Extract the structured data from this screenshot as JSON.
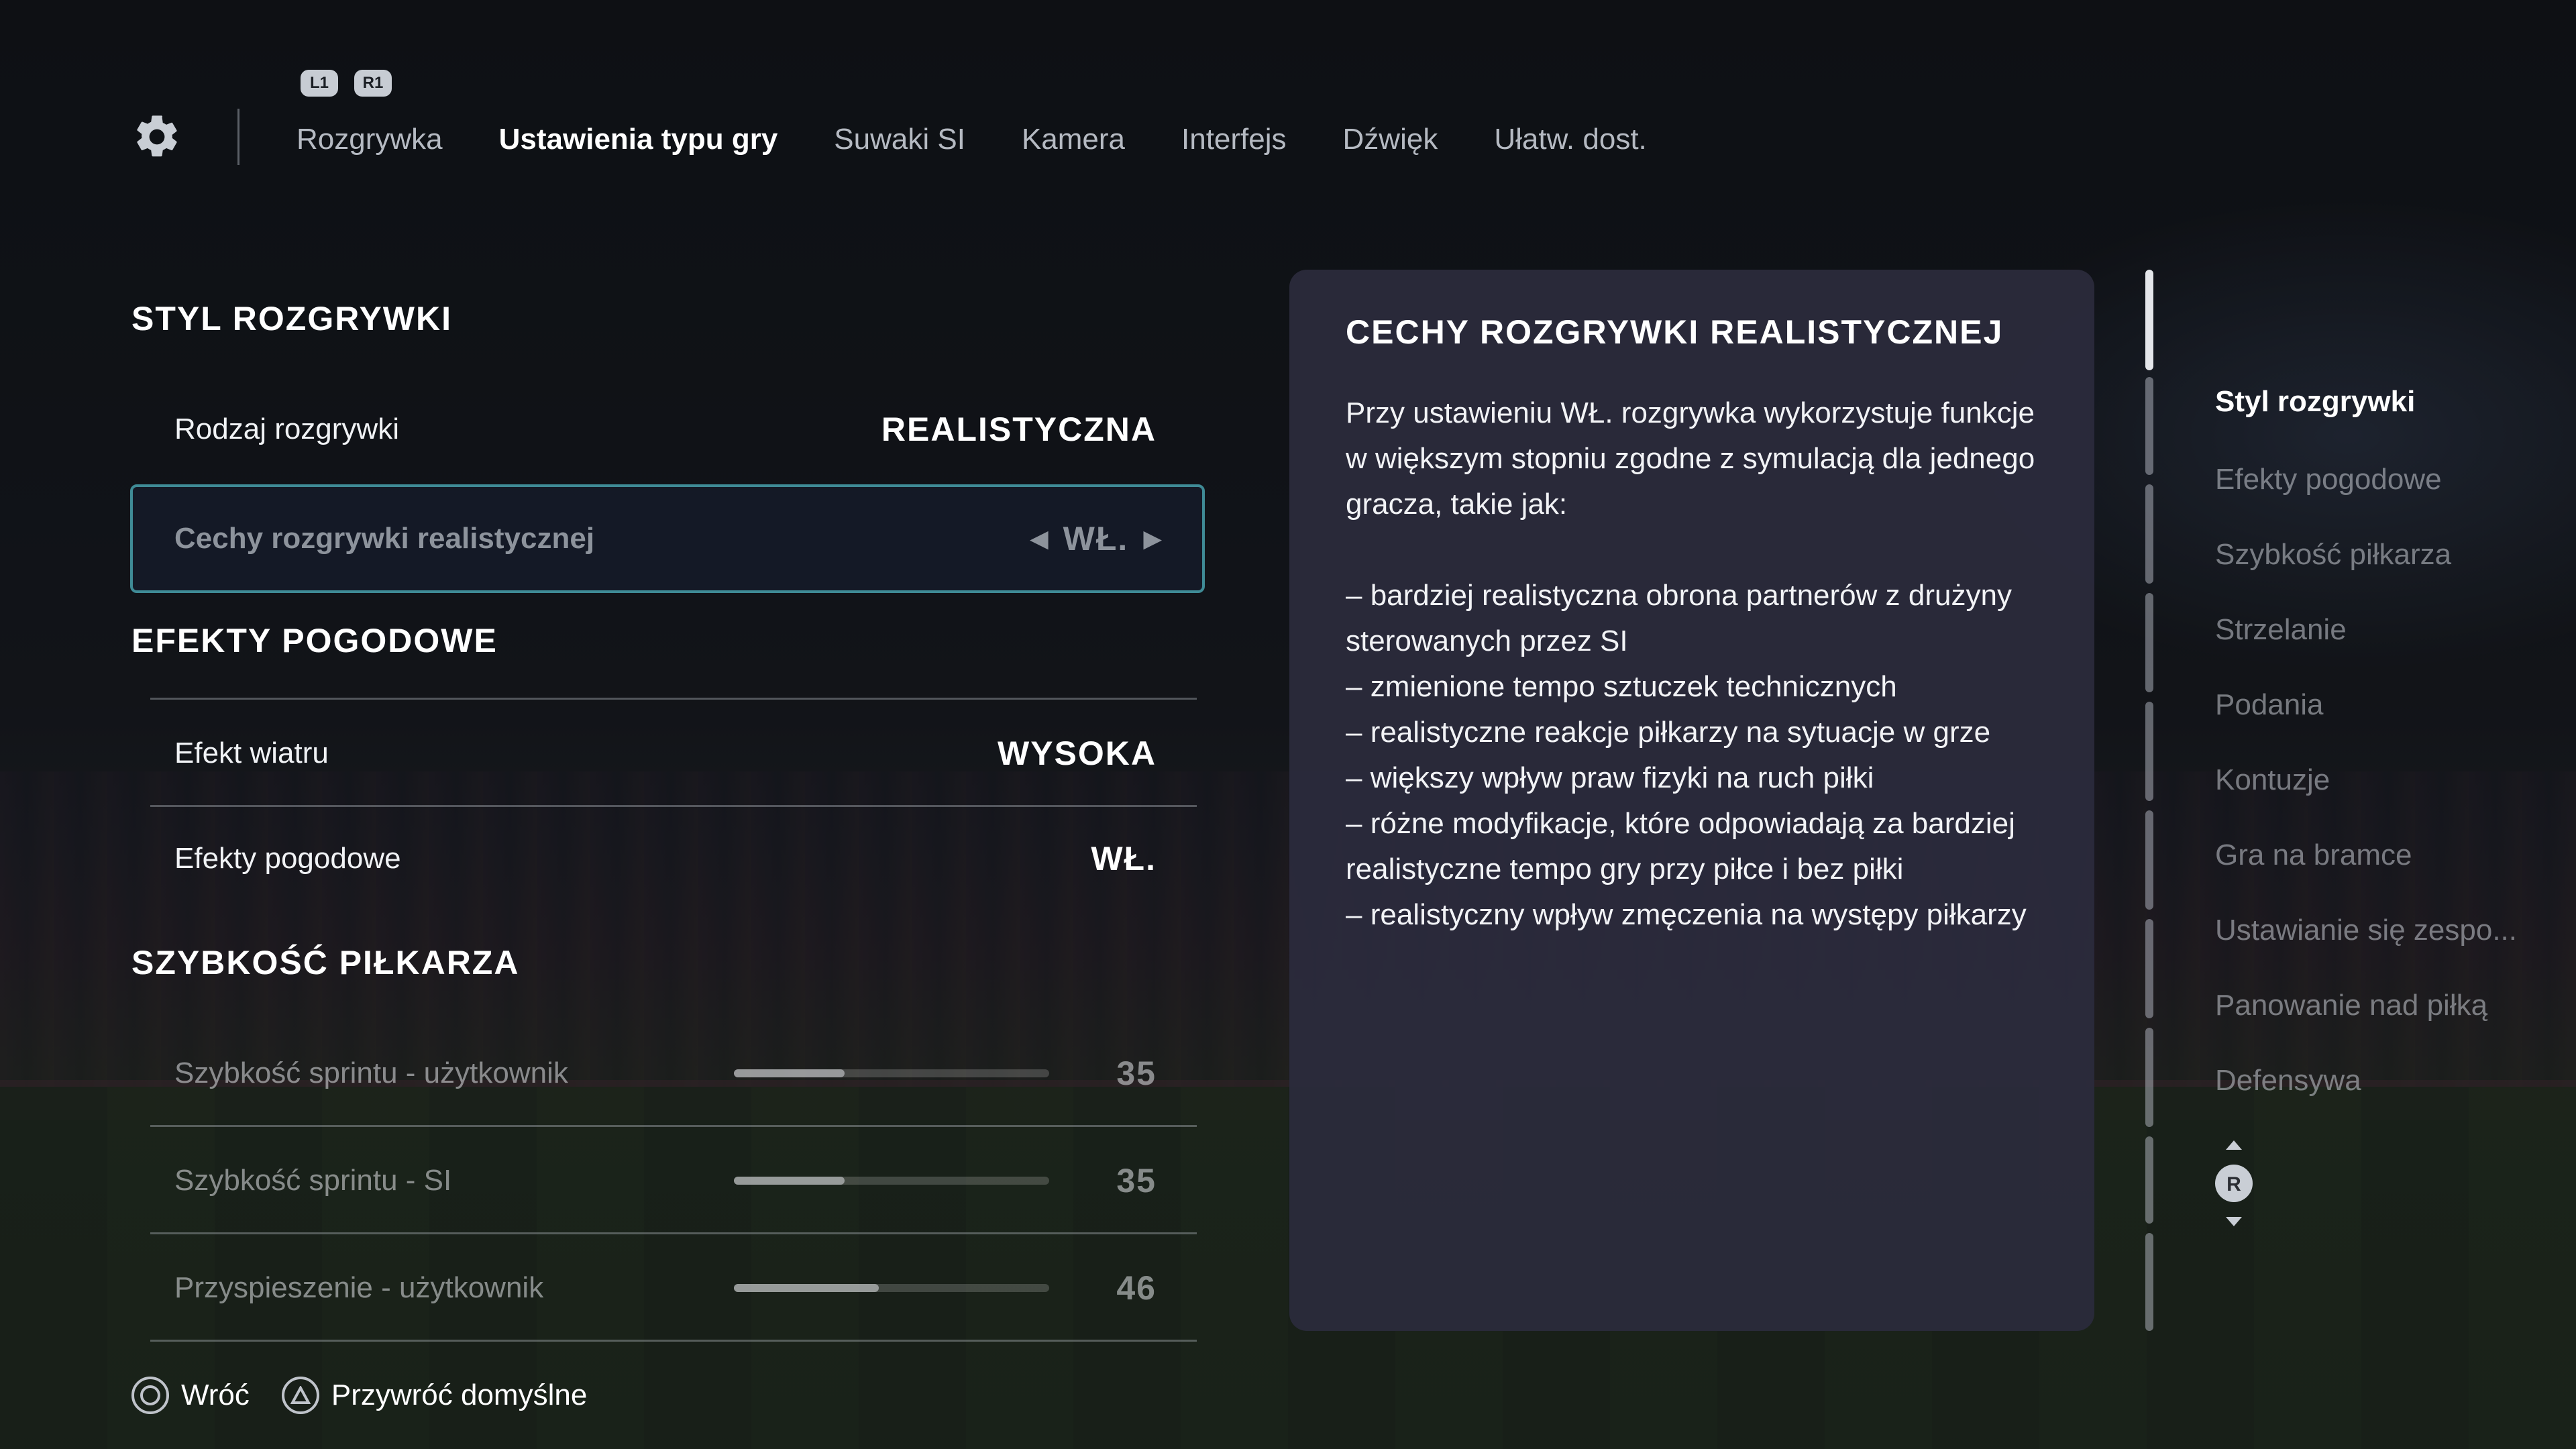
{
  "header": {
    "shoulder_left": "L1",
    "shoulder_right": "R1",
    "tabs": [
      {
        "label": "Rozgrywka",
        "active": false
      },
      {
        "label": "Ustawienia typu gry",
        "active": true
      },
      {
        "label": "Suwaki SI",
        "active": false
      },
      {
        "label": "Kamera",
        "active": false
      },
      {
        "label": "Interfejs",
        "active": false
      },
      {
        "label": "Dźwięk",
        "active": false
      },
      {
        "label": "Ułatw. dost.",
        "active": false
      }
    ]
  },
  "sections": {
    "style": {
      "title": "STYL ROZGRYWKI",
      "rows": [
        {
          "label": "Rodzaj rozgrywki",
          "value": "REALISTYCZNA"
        },
        {
          "label": "Cechy rozgrywki realistycznej",
          "value": "WŁ."
        }
      ]
    },
    "weather": {
      "title": "EFEKTY POGODOWE",
      "rows": [
        {
          "label": "Efekt wiatru",
          "value": "WYSOKA"
        },
        {
          "label": "Efekty pogodowe",
          "value": "WŁ."
        }
      ]
    },
    "speed": {
      "title": "SZYBKOŚĆ PIŁKARZA",
      "rows": [
        {
          "label": "Szybkość sprintu - użytkownik",
          "value": "35",
          "level": 35
        },
        {
          "label": "Szybkość sprintu - SI",
          "value": "35",
          "level": 35
        },
        {
          "label": "Przyspieszenie - użytkownik",
          "value": "46",
          "level": 46
        }
      ]
    }
  },
  "info_panel": {
    "title": "CECHY ROZGRYWKI REALISTYCZNEJ",
    "intro": "Przy ustawieniu WŁ. rozgrywka wykorzystuje funkcje w większym stopniu zgodne z symulacją dla jednego gracza, takie jak:",
    "bullets": [
      "– bardziej realistyczna obrona partnerów z drużyny sterowanych przez SI",
      "– zmienione tempo sztuczek technicznych",
      "– realistyczne reakcje piłkarzy na sytuacje w grze",
      "– większy wpływ praw fizyki na ruch piłki",
      "– różne modyfikacje, które odpowiadają za bardziej realistyczne tempo gry przy piłce i bez piłki",
      "– realistyczny wpływ zmęczenia na występy piłkarzy"
    ]
  },
  "right_nav": {
    "items": [
      {
        "label": "Styl rozgrywki",
        "active": true
      },
      {
        "label": "Efekty pogodowe",
        "active": false
      },
      {
        "label": "Szybkość piłkarza",
        "active": false
      },
      {
        "label": "Strzelanie",
        "active": false
      },
      {
        "label": "Podania",
        "active": false
      },
      {
        "label": "Kontuzje",
        "active": false
      },
      {
        "label": "Gra na bramce",
        "active": false
      },
      {
        "label": "Ustawianie się zespo...",
        "active": false
      },
      {
        "label": "Panowanie nad piłką",
        "active": false
      },
      {
        "label": "Defensywa",
        "active": false
      }
    ],
    "stick_label": "R"
  },
  "footer": {
    "back_label": "Wróć",
    "reset_label": "Przywróć domyślne"
  },
  "colors": {
    "accent_border": "#3f8b96",
    "panel_bg": "#2b2b3c"
  }
}
